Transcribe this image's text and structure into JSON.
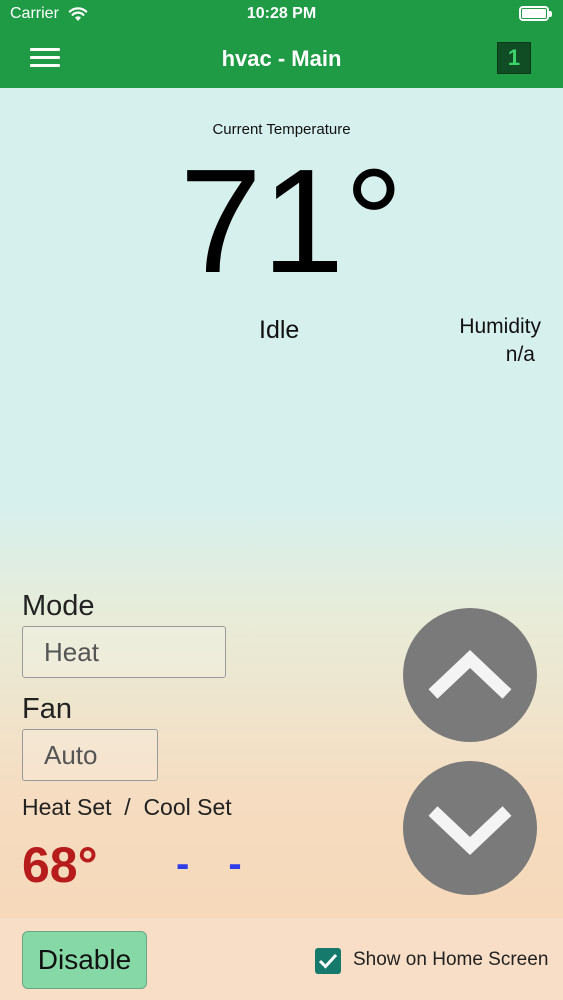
{
  "status_bar": {
    "carrier": "Carrier",
    "time": "10:28 PM"
  },
  "nav": {
    "title": "hvac - Main",
    "badge": "1"
  },
  "current": {
    "label": "Current Temperature",
    "temperature": "71°",
    "state": "Idle",
    "humidity_label": "Humidity",
    "humidity_value": "n/a"
  },
  "controls": {
    "mode_label": "Mode",
    "mode_value": "Heat",
    "fan_label": "Fan",
    "fan_value": "Auto",
    "setpoint_label": "Heat Set  /  Cool Set",
    "heat_set": "68°",
    "cool_set": "- -"
  },
  "footer": {
    "disable_label": "Disable",
    "show_home_label": "Show on Home Screen",
    "show_home_checked": true
  },
  "colors": {
    "header": "#1f9b46",
    "heat": "#b71c1c",
    "cool": "#2f3ee8",
    "disable_button": "#86d9a6",
    "checkbox": "#157a6b"
  },
  "icons": [
    "wifi-icon",
    "battery-icon",
    "menu-icon",
    "chevron-up-icon",
    "chevron-down-icon",
    "checkmark-icon"
  ]
}
